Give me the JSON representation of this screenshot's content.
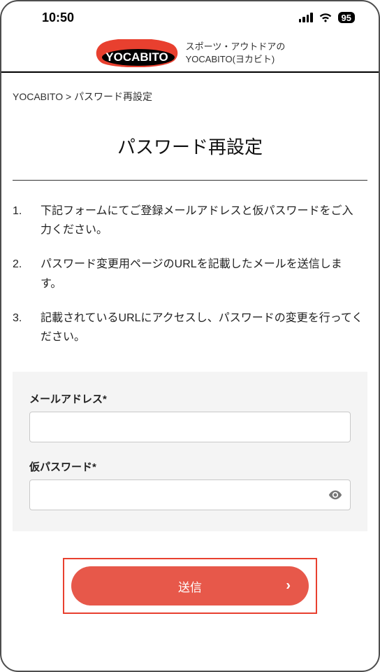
{
  "status": {
    "time": "10:50",
    "battery": "95"
  },
  "header": {
    "brand": "YOCABITO",
    "tagline_line1": "スポーツ・アウトドアの",
    "tagline_line2": "YOCABITO(ヨカビト)"
  },
  "breadcrumb": {
    "root": "YOCABITO",
    "separator": ">",
    "current": "パスワード再設定"
  },
  "page": {
    "title": "パスワード再設定",
    "steps": [
      "下記フォームにてご登録メールアドレスと仮パスワードをご入力ください。",
      "パスワード変更用ページのURLを記載したメールを送信します。",
      "記載されているURLにアクセスし、パスワードの変更を行ってください。"
    ]
  },
  "form": {
    "email_label": "メールアドレス*",
    "password_label": "仮パスワード*",
    "submit_label": "送信"
  },
  "colors": {
    "accent": "#e7584a",
    "accent_border": "#e8402f"
  }
}
